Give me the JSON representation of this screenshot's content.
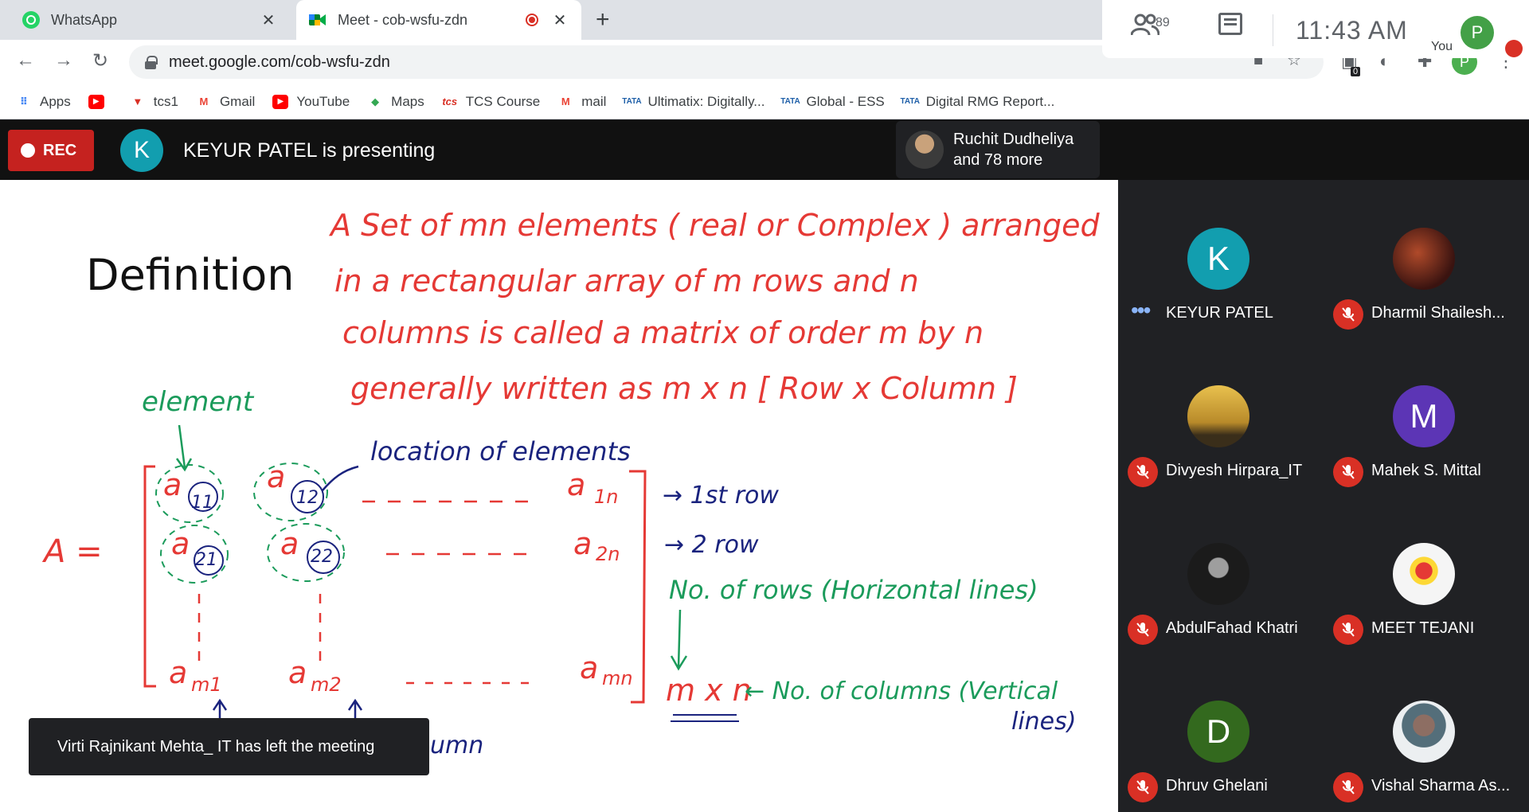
{
  "browser": {
    "tabs": [
      {
        "title": "WhatsApp",
        "active": false,
        "icon": "whatsapp-icon"
      },
      {
        "title": "Meet - cob-wsfu-zdn",
        "active": true,
        "icon": "meet-icon"
      }
    ],
    "url": "meet.google.com/cob-wsfu-zdn",
    "extension_badge": "0",
    "profile_initial": "P",
    "bookmarks": [
      {
        "label": "Apps",
        "icon": "apps-icon"
      },
      {
        "label": "",
        "icon": "youtube-icon"
      },
      {
        "label": "tcs1",
        "icon": "tata-icon"
      },
      {
        "label": "Gmail",
        "icon": "gmail-icon"
      },
      {
        "label": "YouTube",
        "icon": "youtube-icon"
      },
      {
        "label": "Maps",
        "icon": "maps-icon"
      },
      {
        "label": "TCS Course",
        "icon": "tcs-icon"
      },
      {
        "label": "mail",
        "icon": "gmail-icon"
      },
      {
        "label": "Ultimatix: Digitally...",
        "icon": "tata-icon"
      },
      {
        "label": "Global - ESS",
        "icon": "tata-icon"
      },
      {
        "label": "Digital RMG Report...",
        "icon": "tata-icon"
      }
    ]
  },
  "meet": {
    "rec_label": "REC",
    "presenter_initial": "K",
    "presenting_text": "KEYUR PATEL is presenting",
    "others_line1": "Ruchit Dudheliya",
    "others_line2": "and 78 more",
    "participant_count": "89",
    "time": "11:43  AM",
    "you_label": "You",
    "you_initial": "P",
    "toast": "Virti Rajnikant Mehta_ IT has left the meeting"
  },
  "slide": {
    "title": "Definition",
    "handwriting": {
      "line1": "A  Set  of  mn  elements ( real or Complex )  arranged",
      "line2": "in  a  rectangular  array  of  m  rows  and  n",
      "line3": "columns  is  called  a  matrix  of  order  m  by  n",
      "line4": "generally  written  as  m x n   [ Row x Column ]",
      "element": "element",
      "location": "location of elements",
      "A_eq": "A  =",
      "a": "a",
      "s11": "11",
      "s12": "12",
      "s1n": "1n",
      "s21": "21",
      "s22": "22",
      "s2n": "2n",
      "sm1": "m1",
      "sm2": "m2",
      "smn": "mn",
      "row1": "→ 1st  row",
      "row2": "→ 2  row",
      "rows_note": "No. of rows (Horizontal lines)",
      "mxn": "m x n",
      "cols_note1": "← No. of columns (Vertical",
      "cols_note2": "lines)",
      "column_partial": "umn"
    }
  },
  "participants": [
    {
      "name": "KEYUR PATEL",
      "initial": "K",
      "color": "#129eaf",
      "muted": false,
      "avatar": "letter"
    },
    {
      "name": "Dharmil Shailesh...",
      "initial": "",
      "color": "#5a2320",
      "muted": true,
      "avatar": "photo"
    },
    {
      "name": "Divyesh Hirpara_IT",
      "initial": "",
      "color": "#d8b04a",
      "muted": true,
      "avatar": "photo"
    },
    {
      "name": "Mahek S. Mittal",
      "initial": "M",
      "color": "#5c35b5",
      "muted": true,
      "avatar": "letter"
    },
    {
      "name": "AbdulFahad Khatri",
      "initial": "",
      "color": "#2a2a2a",
      "muted": true,
      "avatar": "photo"
    },
    {
      "name": "MEET TEJANI",
      "initial": "",
      "color": "#e8e8e8",
      "muted": true,
      "avatar": "photo"
    },
    {
      "name": "Dhruv Ghelani",
      "initial": "D",
      "color": "#33691e",
      "muted": true,
      "avatar": "letter"
    },
    {
      "name": "Vishal Sharma As...",
      "initial": "",
      "color": "#cfd8dc",
      "muted": true,
      "avatar": "photo"
    }
  ]
}
